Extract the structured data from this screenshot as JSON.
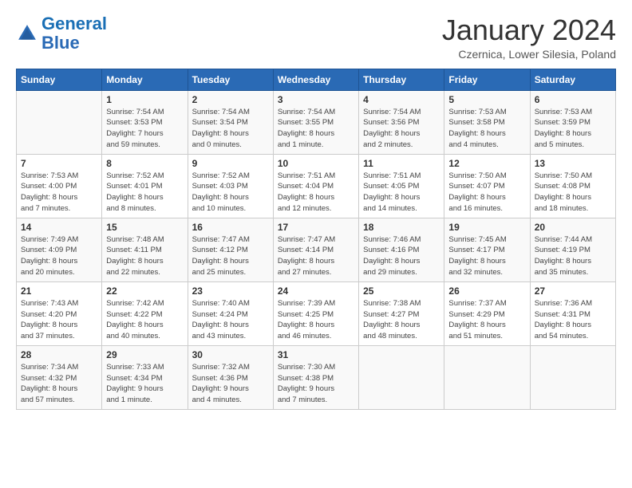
{
  "logo": {
    "text1": "General",
    "text2": "Blue"
  },
  "title": "January 2024",
  "subtitle": "Czernica, Lower Silesia, Poland",
  "days_header": [
    "Sunday",
    "Monday",
    "Tuesday",
    "Wednesday",
    "Thursday",
    "Friday",
    "Saturday"
  ],
  "weeks": [
    [
      {
        "num": "",
        "info": ""
      },
      {
        "num": "1",
        "info": "Sunrise: 7:54 AM\nSunset: 3:53 PM\nDaylight: 7 hours\nand 59 minutes."
      },
      {
        "num": "2",
        "info": "Sunrise: 7:54 AM\nSunset: 3:54 PM\nDaylight: 8 hours\nand 0 minutes."
      },
      {
        "num": "3",
        "info": "Sunrise: 7:54 AM\nSunset: 3:55 PM\nDaylight: 8 hours\nand 1 minute."
      },
      {
        "num": "4",
        "info": "Sunrise: 7:54 AM\nSunset: 3:56 PM\nDaylight: 8 hours\nand 2 minutes."
      },
      {
        "num": "5",
        "info": "Sunrise: 7:53 AM\nSunset: 3:58 PM\nDaylight: 8 hours\nand 4 minutes."
      },
      {
        "num": "6",
        "info": "Sunrise: 7:53 AM\nSunset: 3:59 PM\nDaylight: 8 hours\nand 5 minutes."
      }
    ],
    [
      {
        "num": "7",
        "info": "Sunrise: 7:53 AM\nSunset: 4:00 PM\nDaylight: 8 hours\nand 7 minutes."
      },
      {
        "num": "8",
        "info": "Sunrise: 7:52 AM\nSunset: 4:01 PM\nDaylight: 8 hours\nand 8 minutes."
      },
      {
        "num": "9",
        "info": "Sunrise: 7:52 AM\nSunset: 4:03 PM\nDaylight: 8 hours\nand 10 minutes."
      },
      {
        "num": "10",
        "info": "Sunrise: 7:51 AM\nSunset: 4:04 PM\nDaylight: 8 hours\nand 12 minutes."
      },
      {
        "num": "11",
        "info": "Sunrise: 7:51 AM\nSunset: 4:05 PM\nDaylight: 8 hours\nand 14 minutes."
      },
      {
        "num": "12",
        "info": "Sunrise: 7:50 AM\nSunset: 4:07 PM\nDaylight: 8 hours\nand 16 minutes."
      },
      {
        "num": "13",
        "info": "Sunrise: 7:50 AM\nSunset: 4:08 PM\nDaylight: 8 hours\nand 18 minutes."
      }
    ],
    [
      {
        "num": "14",
        "info": "Sunrise: 7:49 AM\nSunset: 4:09 PM\nDaylight: 8 hours\nand 20 minutes."
      },
      {
        "num": "15",
        "info": "Sunrise: 7:48 AM\nSunset: 4:11 PM\nDaylight: 8 hours\nand 22 minutes."
      },
      {
        "num": "16",
        "info": "Sunrise: 7:47 AM\nSunset: 4:12 PM\nDaylight: 8 hours\nand 25 minutes."
      },
      {
        "num": "17",
        "info": "Sunrise: 7:47 AM\nSunset: 4:14 PM\nDaylight: 8 hours\nand 27 minutes."
      },
      {
        "num": "18",
        "info": "Sunrise: 7:46 AM\nSunset: 4:16 PM\nDaylight: 8 hours\nand 29 minutes."
      },
      {
        "num": "19",
        "info": "Sunrise: 7:45 AM\nSunset: 4:17 PM\nDaylight: 8 hours\nand 32 minutes."
      },
      {
        "num": "20",
        "info": "Sunrise: 7:44 AM\nSunset: 4:19 PM\nDaylight: 8 hours\nand 35 minutes."
      }
    ],
    [
      {
        "num": "21",
        "info": "Sunrise: 7:43 AM\nSunset: 4:20 PM\nDaylight: 8 hours\nand 37 minutes."
      },
      {
        "num": "22",
        "info": "Sunrise: 7:42 AM\nSunset: 4:22 PM\nDaylight: 8 hours\nand 40 minutes."
      },
      {
        "num": "23",
        "info": "Sunrise: 7:40 AM\nSunset: 4:24 PM\nDaylight: 8 hours\nand 43 minutes."
      },
      {
        "num": "24",
        "info": "Sunrise: 7:39 AM\nSunset: 4:25 PM\nDaylight: 8 hours\nand 46 minutes."
      },
      {
        "num": "25",
        "info": "Sunrise: 7:38 AM\nSunset: 4:27 PM\nDaylight: 8 hours\nand 48 minutes."
      },
      {
        "num": "26",
        "info": "Sunrise: 7:37 AM\nSunset: 4:29 PM\nDaylight: 8 hours\nand 51 minutes."
      },
      {
        "num": "27",
        "info": "Sunrise: 7:36 AM\nSunset: 4:31 PM\nDaylight: 8 hours\nand 54 minutes."
      }
    ],
    [
      {
        "num": "28",
        "info": "Sunrise: 7:34 AM\nSunset: 4:32 PM\nDaylight: 8 hours\nand 57 minutes."
      },
      {
        "num": "29",
        "info": "Sunrise: 7:33 AM\nSunset: 4:34 PM\nDaylight: 9 hours\nand 1 minute."
      },
      {
        "num": "30",
        "info": "Sunrise: 7:32 AM\nSunset: 4:36 PM\nDaylight: 9 hours\nand 4 minutes."
      },
      {
        "num": "31",
        "info": "Sunrise: 7:30 AM\nSunset: 4:38 PM\nDaylight: 9 hours\nand 7 minutes."
      },
      {
        "num": "",
        "info": ""
      },
      {
        "num": "",
        "info": ""
      },
      {
        "num": "",
        "info": ""
      }
    ]
  ]
}
